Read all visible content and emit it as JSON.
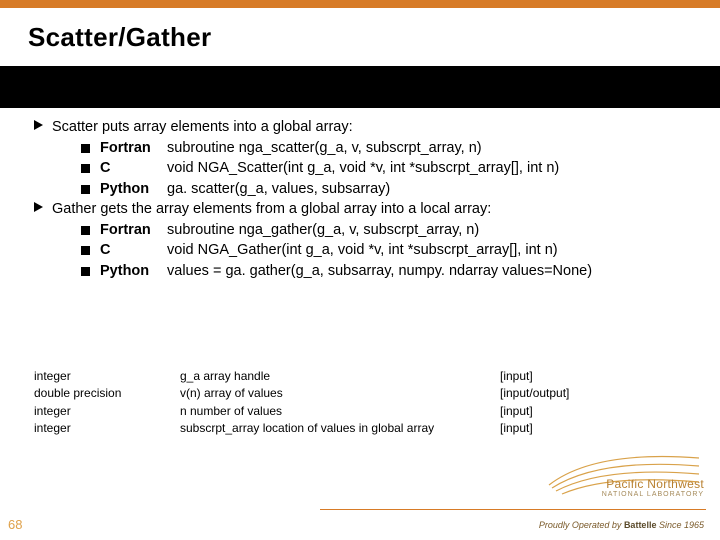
{
  "title": "Scatter/Gather",
  "page_number": "68",
  "bullets": [
    {
      "text": "Scatter puts array elements into a global array:",
      "sub": [
        {
          "lang": "Fortran",
          "code": "subroutine nga_scatter(g_a, v, subscrpt_array, n)"
        },
        {
          "lang": "C",
          "code": "void NGA_Scatter(int g_a, void *v, int *subscrpt_array[], int n)"
        },
        {
          "lang": "Python",
          "code": "ga. scatter(g_a, values, subsarray)"
        }
      ]
    },
    {
      "text": "Gather gets the array elements from a global array into a local array:",
      "sub": [
        {
          "lang": "Fortran",
          "code": "subroutine nga_gather(g_a, v, subscrpt_array, n)"
        },
        {
          "lang": "C",
          "code": "void NGA_Gather(int g_a, void *v, int *subscrpt_array[], int n)"
        },
        {
          "lang": "Python",
          "code": "values = ga. gather(g_a, subsarray, numpy. ndarray values=None)"
        }
      ]
    }
  ],
  "params": [
    {
      "type": "integer",
      "desc": "g_a array handle",
      "dir": "[input]"
    },
    {
      "type": "double precision",
      "desc": "v(n) array of values",
      "dir": "[input/output]"
    },
    {
      "type": "integer",
      "desc": "n number of values",
      "dir": "[input]"
    },
    {
      "type": "integer",
      "desc": "subscrpt_array location of values in global array",
      "dir": "[input]"
    }
  ],
  "logo": {
    "line1": "Pacific Northwest",
    "line2": "NATIONAL LABORATORY"
  },
  "footer": {
    "prefix": "Proudly Operated by ",
    "brand": "Battelle",
    "suffix": " Since 1965"
  }
}
